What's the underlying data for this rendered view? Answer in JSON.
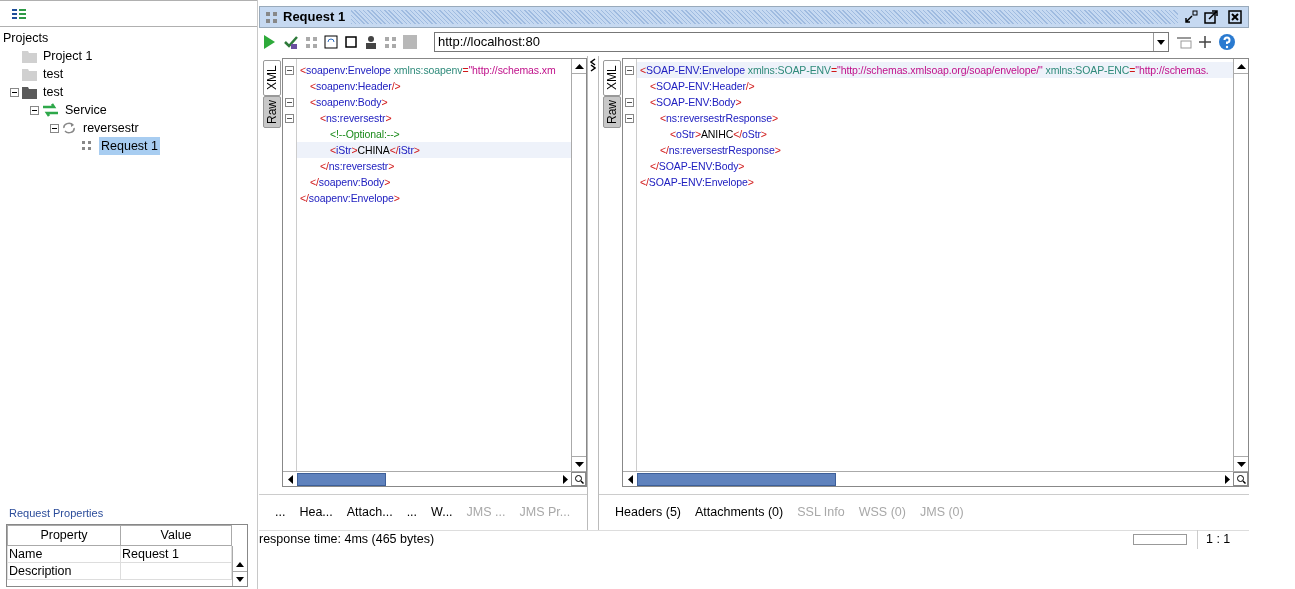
{
  "navigator": {
    "title": "Projects",
    "items": [
      {
        "label": "Project 1",
        "kind": "project",
        "opened": false,
        "expanded": false,
        "selected": false
      },
      {
        "label": "test",
        "kind": "project",
        "opened": false,
        "expanded": false,
        "selected": false
      },
      {
        "label": "test",
        "kind": "project",
        "opened": true,
        "expanded": true,
        "selected": false,
        "children": [
          {
            "label": "Service",
            "kind": "interface",
            "expanded": true,
            "selected": false,
            "children": [
              {
                "label": "reversestr",
                "kind": "operation",
                "expanded": true,
                "selected": false,
                "children": [
                  {
                    "label": "Request 1",
                    "kind": "request",
                    "expanded": false,
                    "selected": true
                  }
                ]
              }
            ]
          }
        ]
      }
    ]
  },
  "properties": {
    "title": "Request Properties",
    "columns": [
      "Property",
      "Value"
    ],
    "rows": [
      [
        "Name",
        "Request 1"
      ],
      [
        "Description",
        ""
      ]
    ]
  },
  "request_window": {
    "title": "Request 1",
    "endpoint": "http://localhost:80",
    "request": {
      "side_tabs": [
        {
          "label": "XML",
          "selected": true
        },
        {
          "label": "Raw",
          "selected": false
        }
      ],
      "xml": [
        {
          "highlighted": false,
          "open": [
            {
              "kind": "bracket",
              "text": "<"
            },
            {
              "kind": "tag",
              "text": "soapenv:Envelope"
            },
            {
              "kind": "attr",
              "text": " xmlns:soapenv"
            },
            {
              "kind": "bracket",
              "text": "="
            },
            {
              "kind": "value",
              "text": "\"http://schemas.xm"
            }
          ],
          "close": [
            {
              "kind": "bracket",
              "text": "</"
            },
            {
              "kind": "tag",
              "text": "soapenv:Envelope"
            },
            {
              "kind": "bracket",
              "text": ">"
            }
          ],
          "children": [
            {
              "highlighted": false,
              "open": [
                {
                  "kind": "bracket",
                  "text": "<"
                },
                {
                  "kind": "tag",
                  "text": "soapenv:Header"
                },
                {
                  "kind": "bracket",
                  "text": "/>"
                }
              ]
            },
            {
              "highlighted": false,
              "open": [
                {
                  "kind": "bracket",
                  "text": "<"
                },
                {
                  "kind": "tag",
                  "text": "soapenv:Body"
                },
                {
                  "kind": "bracket",
                  "text": ">"
                }
              ],
              "close": [
                {
                  "kind": "bracket",
                  "text": "</"
                },
                {
                  "kind": "tag",
                  "text": "soapenv:Body"
                },
                {
                  "kind": "bracket",
                  "text": ">"
                }
              ],
              "children": [
                {
                  "highlighted": false,
                  "open": [
                    {
                      "kind": "bracket",
                      "text": "<"
                    },
                    {
                      "kind": "tag",
                      "text": "ns:reversestr"
                    },
                    {
                      "kind": "bracket",
                      "text": ">"
                    }
                  ],
                  "close": [
                    {
                      "kind": "bracket",
                      "text": "</"
                    },
                    {
                      "kind": "tag",
                      "text": "ns:reversestr"
                    },
                    {
                      "kind": "bracket",
                      "text": ">"
                    }
                  ],
                  "children": [
                    {
                      "highlighted": false,
                      "open": [
                        {
                          "kind": "comment",
                          "text": "<!--Optional:-->"
                        }
                      ]
                    },
                    {
                      "highlighted": true,
                      "open": [
                        {
                          "kind": "bracket",
                          "text": "<"
                        },
                        {
                          "kind": "tag",
                          "text": "iStr"
                        },
                        {
                          "kind": "bracket",
                          "text": ">"
                        },
                        {
                          "kind": "text",
                          "text": "CHINA"
                        },
                        {
                          "kind": "bracket",
                          "text": "</"
                        },
                        {
                          "kind": "tag",
                          "text": "iStr"
                        },
                        {
                          "kind": "bracket",
                          "text": ">"
                        }
                      ]
                    }
                  ]
                }
              ]
            }
          ]
        }
      ],
      "tabs": [
        {
          "label": "...",
          "disabled": false
        },
        {
          "label": "Hea...",
          "disabled": false
        },
        {
          "label": "Attach...",
          "disabled": false
        },
        {
          "label": "...",
          "disabled": false
        },
        {
          "label": "W...",
          "disabled": false
        },
        {
          "label": "JMS ...",
          "disabled": true
        },
        {
          "label": "JMS Pr...",
          "disabled": true
        }
      ]
    },
    "response": {
      "side_tabs": [
        {
          "label": "XML",
          "selected": true
        },
        {
          "label": "Raw",
          "selected": false
        }
      ],
      "xml": [
        {
          "highlighted": true,
          "open": [
            {
              "kind": "bracket",
              "text": "<"
            },
            {
              "kind": "tag",
              "text": "SOAP-ENV:Envelope"
            },
            {
              "kind": "attr",
              "text": " xmlns:SOAP-ENV"
            },
            {
              "kind": "bracket",
              "text": "="
            },
            {
              "kind": "value",
              "text": "\"http://schemas.xmlsoap.org/soap/envelope/\""
            },
            {
              "kind": "attr",
              "text": " xmlns:SOAP-ENC"
            },
            {
              "kind": "bracket",
              "text": "="
            },
            {
              "kind": "value",
              "text": "\"http://schemas."
            }
          ],
          "close": [
            {
              "kind": "bracket",
              "text": "</"
            },
            {
              "kind": "tag",
              "text": "SOAP-ENV:Envelope"
            },
            {
              "kind": "bracket",
              "text": ">"
            }
          ],
          "children": [
            {
              "highlighted": false,
              "open": [
                {
                  "kind": "bracket",
                  "text": "<"
                },
                {
                  "kind": "tag",
                  "text": "SOAP-ENV:Header"
                },
                {
                  "kind": "bracket",
                  "text": "/>"
                }
              ]
            },
            {
              "highlighted": false,
              "open": [
                {
                  "kind": "bracket",
                  "text": "<"
                },
                {
                  "kind": "tag",
                  "text": "SOAP-ENV:Body"
                },
                {
                  "kind": "bracket",
                  "text": ">"
                }
              ],
              "close": [
                {
                  "kind": "bracket",
                  "text": "</"
                },
                {
                  "kind": "tag",
                  "text": "SOAP-ENV:Body"
                },
                {
                  "kind": "bracket",
                  "text": ">"
                }
              ],
              "children": [
                {
                  "highlighted": false,
                  "open": [
                    {
                      "kind": "bracket",
                      "text": "<"
                    },
                    {
                      "kind": "tag",
                      "text": "ns:reversestrResponse"
                    },
                    {
                      "kind": "bracket",
                      "text": ">"
                    }
                  ],
                  "close": [
                    {
                      "kind": "bracket",
                      "text": "</"
                    },
                    {
                      "kind": "tag",
                      "text": "ns:reversestrResponse"
                    },
                    {
                      "kind": "bracket",
                      "text": ">"
                    }
                  ],
                  "children": [
                    {
                      "highlighted": false,
                      "open": [
                        {
                          "kind": "bracket",
                          "text": "<"
                        },
                        {
                          "kind": "tag",
                          "text": "oStr"
                        },
                        {
                          "kind": "bracket",
                          "text": ">"
                        },
                        {
                          "kind": "text",
                          "text": "ANIHC"
                        },
                        {
                          "kind": "bracket",
                          "text": "</"
                        },
                        {
                          "kind": "tag",
                          "text": "oStr"
                        },
                        {
                          "kind": "bracket",
                          "text": ">"
                        }
                      ]
                    }
                  ]
                }
              ]
            }
          ]
        }
      ],
      "tabs": [
        {
          "label": "Headers (5)",
          "disabled": false
        },
        {
          "label": "Attachments (0)",
          "disabled": false
        },
        {
          "label": "SSL Info",
          "disabled": true
        },
        {
          "label": "WSS (0)",
          "disabled": true
        },
        {
          "label": "JMS (0)",
          "disabled": true
        }
      ]
    },
    "status": "response time: 4ms (465 bytes)",
    "progress": {
      "level": 0
    },
    "position": "1 : 1"
  }
}
